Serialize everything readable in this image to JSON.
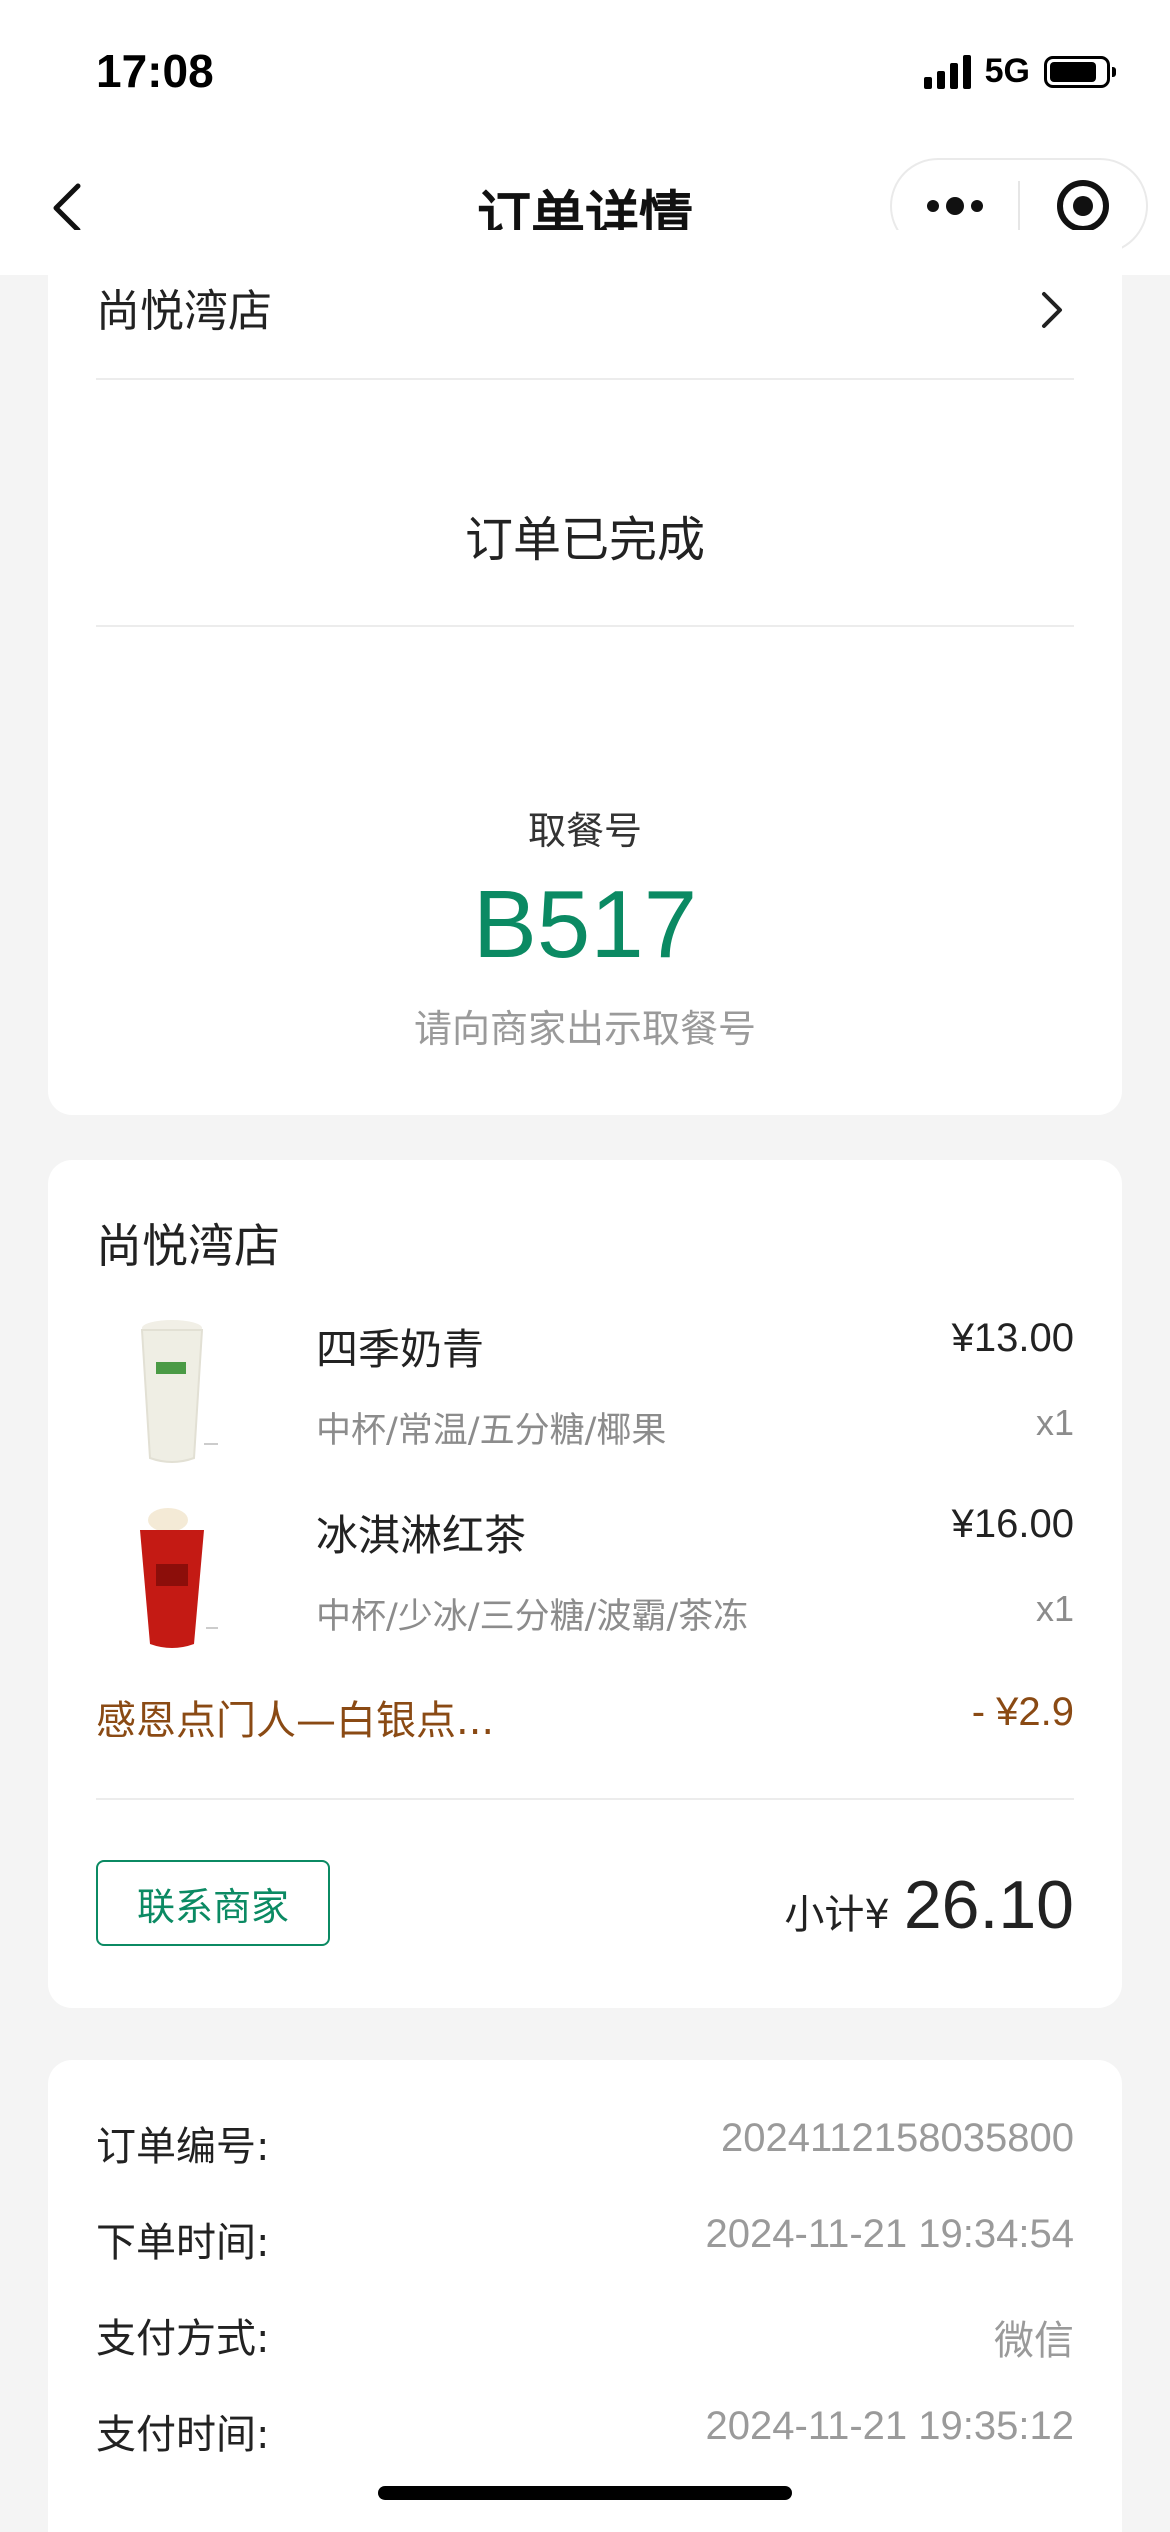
{
  "status_bar": {
    "time": "17:08",
    "network": "5G",
    "battery_level": 0.85
  },
  "nav": {
    "title": "订单详情",
    "back_icon": "chevron-left-icon",
    "more_icon": "more-dots-icon",
    "close_icon": "target-icon"
  },
  "order": {
    "store_name": "尚悦湾店",
    "status": "订单已完成",
    "pickup_label": "取餐号",
    "pickup_number": "B517",
    "pickup_hint": "请向商家出示取餐号"
  },
  "items_card": {
    "store_name": "尚悦湾店",
    "items": [
      {
        "name": "四季奶青",
        "spec": "中杯/常温/五分糖/椰果",
        "price": "¥13.00",
        "qty": "x1"
      },
      {
        "name": "冰淇淋红茶",
        "spec": "中杯/少冰/三分糖/波霸/茶冻",
        "price": "¥16.00",
        "qty": "x1"
      }
    ],
    "discount_label": "感恩点门人—白银点...",
    "discount_value": "- ¥2.9",
    "contact_button": "联系商家",
    "subtotal_label": "小计¥",
    "subtotal_value": "26.10"
  },
  "details": [
    {
      "label": "订单编号:",
      "value": "2024112158035800"
    },
    {
      "label": "下单时间:",
      "value": "2024-11-21 19:34:54"
    },
    {
      "label": "支付方式:",
      "value": "微信"
    },
    {
      "label": "支付时间:",
      "value": "2024-11-21 19:35:12"
    }
  ],
  "colors": {
    "accent": "#0b8a63",
    "discount": "#8a4a14",
    "muted": "#9a9a9a"
  }
}
